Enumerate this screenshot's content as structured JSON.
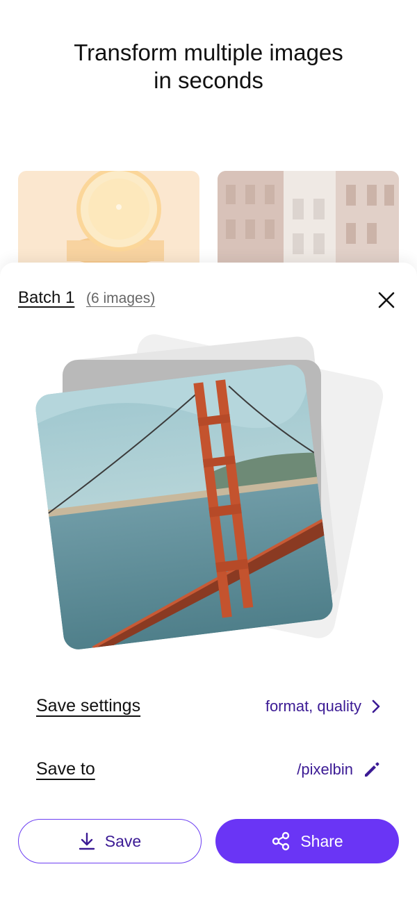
{
  "hero": {
    "title_line1": "Transform multiple images",
    "title_line2": "in seconds"
  },
  "batch": {
    "title": "Batch 1",
    "count": "(6 images)"
  },
  "settings": [
    {
      "label": "Save settings",
      "value": "format, quality",
      "icon": "chevron-right-icon"
    },
    {
      "label": "Save to",
      "value": "/pixelbin",
      "icon": "pencil-icon"
    }
  ],
  "actions": {
    "save_label": "Save",
    "share_label": "Share"
  },
  "colors": {
    "accent": "#6a35f5",
    "accent_text": "#3b1a94"
  }
}
